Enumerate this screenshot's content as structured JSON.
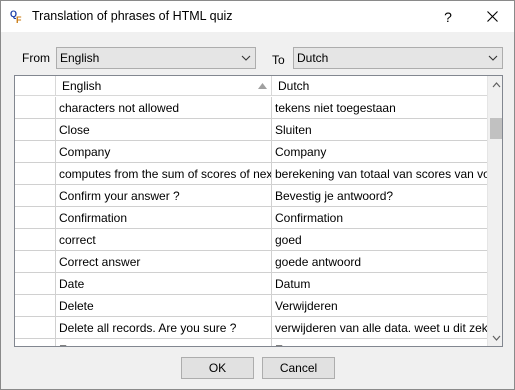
{
  "window": {
    "title": "Translation of phrases of HTML quiz",
    "help_glyph": "?",
    "close_glyph": "✕"
  },
  "languages": {
    "from_label": "From",
    "from_value": "English",
    "to_label": "To",
    "to_value": "Dutch"
  },
  "grid": {
    "columns": [
      "English",
      "Dutch"
    ],
    "rows": [
      {
        "en": "characters not allowed",
        "nl": "tekens niet toegestaan"
      },
      {
        "en": "Close",
        "nl": "Sluiten"
      },
      {
        "en": "Company",
        "nl": "Company"
      },
      {
        "en": "computes from the sum of scores of next ...",
        "nl": "berekening van totaal van scores van vol..."
      },
      {
        "en": "Confirm your answer ?",
        "nl": "Bevestig je antwoord?"
      },
      {
        "en": "Confirmation",
        "nl": "Confirmation"
      },
      {
        "en": "correct",
        "nl": "goed"
      },
      {
        "en": "Correct answer",
        "nl": "goede antwoord"
      },
      {
        "en": "Date",
        "nl": "Datum"
      },
      {
        "en": "Delete",
        "nl": "Verwijderen"
      },
      {
        "en": "Delete all records. Are you sure ?",
        "nl": "verwijderen van alle data. weet u dit zeker?"
      },
      {
        "en": "E...",
        "nl": "E..."
      }
    ]
  },
  "buttons": {
    "ok": "OK",
    "cancel": "Cancel"
  },
  "icons": {
    "app": "app-qf-icon",
    "sort": "sort-ascending-icon",
    "dropdown": "chevron-down-icon",
    "scroll_up": "scroll-up-icon",
    "scroll_down": "scroll-down-icon"
  }
}
